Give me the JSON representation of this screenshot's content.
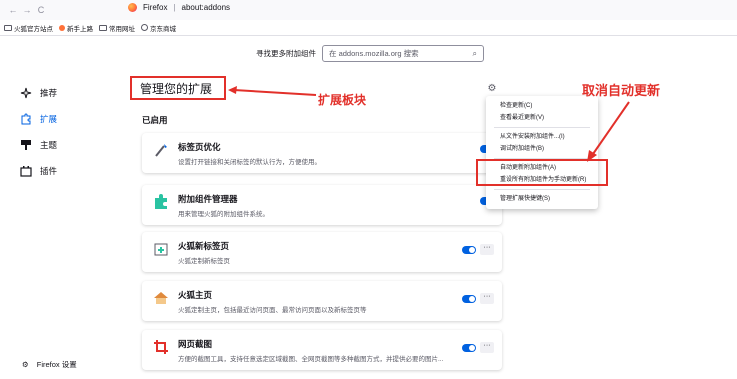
{
  "browser": {
    "tab_title": "Firefox",
    "url": "about:addons",
    "bookmarks": [
      "火狐官方站点",
      "新手上路",
      "常用网址",
      "京东商城"
    ]
  },
  "toolbar": {
    "find_more_label": "寻找更多附加组件",
    "search_placeholder": "在 addons.mozilla.org 搜索"
  },
  "sidebar": {
    "items": [
      {
        "label": "推荐",
        "icon": "sparkle-icon"
      },
      {
        "label": "扩展",
        "icon": "puzzle-icon",
        "active": true
      },
      {
        "label": "主题",
        "icon": "brush-icon"
      },
      {
        "label": "插件",
        "icon": "plugin-icon"
      }
    ],
    "settings_label": "Firefox 设置"
  },
  "main": {
    "title": "管理您的扩展",
    "section_enabled": "已启用",
    "extensions": [
      {
        "name": "标签页优化",
        "desc": "设置打开链接和关闭标签的默认行为，方便使用。",
        "enabled": true
      },
      {
        "name": "附加组件管理器",
        "desc": "用来管理火狐的附加组件系统。",
        "enabled": true
      },
      {
        "name": "火狐新标签页",
        "desc": "火狐定制新标签页",
        "enabled": true
      },
      {
        "name": "火狐主页",
        "desc": "火狐定制主页，包括最近访问页面、最常访问页面以及新标签页等",
        "enabled": true
      },
      {
        "name": "网页截图",
        "desc": "方便的截图工具，支持任意选定区域截图、全网页截图等多种截图方式，并提供必要的图片...",
        "enabled": true
      }
    ]
  },
  "gear_menu": {
    "items": [
      "检查更新(C)",
      "查看最近更新(V)",
      "从文件安装附加组件...(I)",
      "调试附加组件(B)",
      "自动更新附加组件(A)",
      "重设所有附加组件为手动更新(R)",
      "管理扩展快捷键(S)"
    ]
  },
  "annotations": {
    "extension_section": "扩展板块",
    "cancel_auto_update": "取消自动更新",
    "color": "#e2302a"
  }
}
